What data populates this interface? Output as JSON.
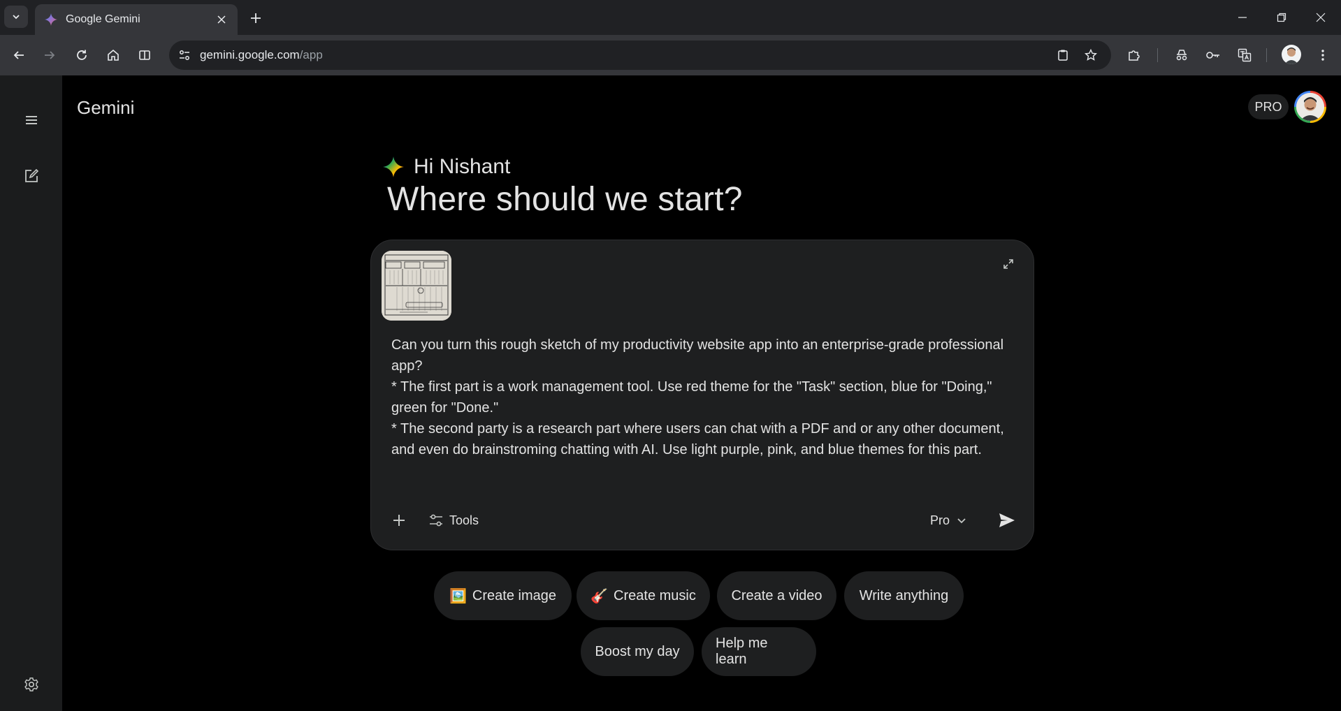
{
  "browser": {
    "tab_title": "Google Gemini",
    "url_host": "gemini.google.com",
    "url_path": "/app"
  },
  "app": {
    "title": "Gemini",
    "plan_badge": "PRO"
  },
  "greeting": {
    "name_line": "Hi Nishant",
    "headline": "Where should we start?"
  },
  "composer": {
    "attachment": "sketch-thumbnail",
    "prompt_lines": [
      "Can you turn this rough sketch of my productivity website app into an enterprise-grade professional app?",
      "* The first part is a work management tool. Use red theme for the \"Task\" section, blue for \"Doing,\" green for \"Done.\"",
      "* The second party is a research part where users can chat with a PDF and or any other document, and even do brainstroming chatting with AI. Use light purple, pink, and blue themes for this part."
    ],
    "tools_label": "Tools",
    "model_label": "Pro"
  },
  "suggestions": [
    {
      "emoji": "🖼️",
      "label": "Create image"
    },
    {
      "emoji": "🎸",
      "label": "Create music"
    },
    {
      "emoji": "",
      "label": "Create a video"
    },
    {
      "emoji": "",
      "label": "Write anything"
    },
    {
      "emoji": "",
      "label": "Boost my day"
    },
    {
      "emoji": "",
      "label": "Help me learn"
    }
  ],
  "colors": {
    "page_bg": "#000000",
    "rail_bg": "#1b1c1d",
    "composer_bg": "#1e1f20",
    "chrome_dark": "#202124",
    "chrome_toolbar": "#35363a",
    "text": "#e3e3e3"
  },
  "icons": {
    "tab_search": "chevron-down-icon",
    "favicon": "gemini-spark-icon",
    "back": "arrow-left-icon",
    "forward": "arrow-right-icon",
    "reload": "reload-icon",
    "home": "home-icon",
    "split": "split-view-icon",
    "menu": "hamburger-menu-icon",
    "new_chat": "edit-icon",
    "settings": "gear-icon",
    "expand": "expand-icon",
    "add": "plus-icon",
    "tools": "tune-icon",
    "send": "send-icon"
  }
}
